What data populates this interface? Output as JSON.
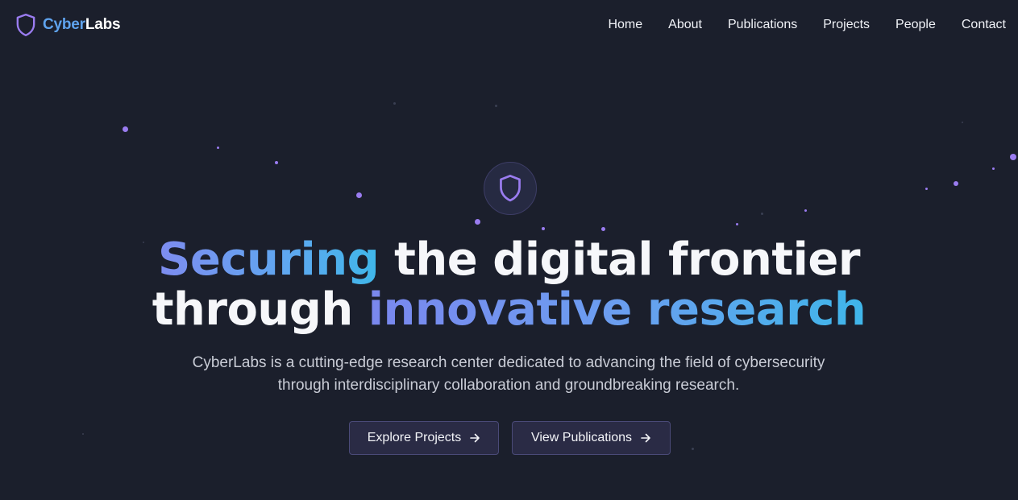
{
  "brand": {
    "name_part1": "Cyber",
    "name_part2": "Labs",
    "logo_icon": "shield-icon",
    "colors": {
      "accent_blue": "#5fa3ee",
      "accent_purple": "#9a7cf0"
    }
  },
  "nav": {
    "items": [
      {
        "label": "Home"
      },
      {
        "label": "About"
      },
      {
        "label": "Publications"
      },
      {
        "label": "Projects"
      },
      {
        "label": "People"
      },
      {
        "label": "Contact"
      }
    ]
  },
  "hero": {
    "badge_icon": "shield-icon",
    "headline": {
      "word1": "Securing",
      "part2": " the digital frontier",
      "part3": "through ",
      "part4": "innovative research"
    },
    "subtitle": "CyberLabs is a cutting-edge research center dedicated to advancing the field of cybersecurity through interdisciplinary collaboration and groundbreaking research.",
    "buttons": {
      "explore": {
        "label": "Explore Projects",
        "icon": "arrow-right-icon"
      },
      "publications": {
        "label": "View Publications",
        "icon": "arrow-right-icon"
      }
    }
  }
}
